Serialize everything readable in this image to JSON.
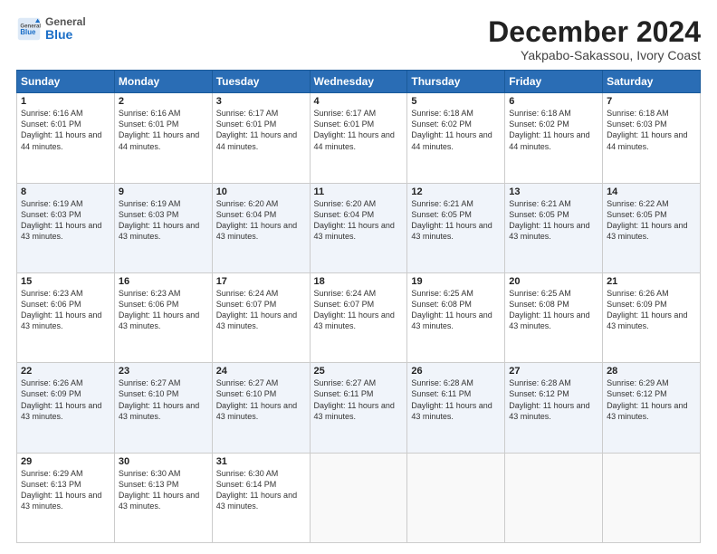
{
  "header": {
    "logo_general": "General",
    "logo_blue": "Blue",
    "month_title": "December 2024",
    "location": "Yakpabo-Sakassou, Ivory Coast"
  },
  "calendar": {
    "days_of_week": [
      "Sunday",
      "Monday",
      "Tuesday",
      "Wednesday",
      "Thursday",
      "Friday",
      "Saturday"
    ],
    "weeks": [
      [
        {
          "day": "1",
          "info": "Sunrise: 6:16 AM\nSunset: 6:01 PM\nDaylight: 11 hours and 44 minutes."
        },
        {
          "day": "2",
          "info": "Sunrise: 6:16 AM\nSunset: 6:01 PM\nDaylight: 11 hours and 44 minutes."
        },
        {
          "day": "3",
          "info": "Sunrise: 6:17 AM\nSunset: 6:01 PM\nDaylight: 11 hours and 44 minutes."
        },
        {
          "day": "4",
          "info": "Sunrise: 6:17 AM\nSunset: 6:01 PM\nDaylight: 11 hours and 44 minutes."
        },
        {
          "day": "5",
          "info": "Sunrise: 6:18 AM\nSunset: 6:02 PM\nDaylight: 11 hours and 44 minutes."
        },
        {
          "day": "6",
          "info": "Sunrise: 6:18 AM\nSunset: 6:02 PM\nDaylight: 11 hours and 44 minutes."
        },
        {
          "day": "7",
          "info": "Sunrise: 6:18 AM\nSunset: 6:03 PM\nDaylight: 11 hours and 44 minutes."
        }
      ],
      [
        {
          "day": "8",
          "info": "Sunrise: 6:19 AM\nSunset: 6:03 PM\nDaylight: 11 hours and 43 minutes."
        },
        {
          "day": "9",
          "info": "Sunrise: 6:19 AM\nSunset: 6:03 PM\nDaylight: 11 hours and 43 minutes."
        },
        {
          "day": "10",
          "info": "Sunrise: 6:20 AM\nSunset: 6:04 PM\nDaylight: 11 hours and 43 minutes."
        },
        {
          "day": "11",
          "info": "Sunrise: 6:20 AM\nSunset: 6:04 PM\nDaylight: 11 hours and 43 minutes."
        },
        {
          "day": "12",
          "info": "Sunrise: 6:21 AM\nSunset: 6:05 PM\nDaylight: 11 hours and 43 minutes."
        },
        {
          "day": "13",
          "info": "Sunrise: 6:21 AM\nSunset: 6:05 PM\nDaylight: 11 hours and 43 minutes."
        },
        {
          "day": "14",
          "info": "Sunrise: 6:22 AM\nSunset: 6:05 PM\nDaylight: 11 hours and 43 minutes."
        }
      ],
      [
        {
          "day": "15",
          "info": "Sunrise: 6:23 AM\nSunset: 6:06 PM\nDaylight: 11 hours and 43 minutes."
        },
        {
          "day": "16",
          "info": "Sunrise: 6:23 AM\nSunset: 6:06 PM\nDaylight: 11 hours and 43 minutes."
        },
        {
          "day": "17",
          "info": "Sunrise: 6:24 AM\nSunset: 6:07 PM\nDaylight: 11 hours and 43 minutes."
        },
        {
          "day": "18",
          "info": "Sunrise: 6:24 AM\nSunset: 6:07 PM\nDaylight: 11 hours and 43 minutes."
        },
        {
          "day": "19",
          "info": "Sunrise: 6:25 AM\nSunset: 6:08 PM\nDaylight: 11 hours and 43 minutes."
        },
        {
          "day": "20",
          "info": "Sunrise: 6:25 AM\nSunset: 6:08 PM\nDaylight: 11 hours and 43 minutes."
        },
        {
          "day": "21",
          "info": "Sunrise: 6:26 AM\nSunset: 6:09 PM\nDaylight: 11 hours and 43 minutes."
        }
      ],
      [
        {
          "day": "22",
          "info": "Sunrise: 6:26 AM\nSunset: 6:09 PM\nDaylight: 11 hours and 43 minutes."
        },
        {
          "day": "23",
          "info": "Sunrise: 6:27 AM\nSunset: 6:10 PM\nDaylight: 11 hours and 43 minutes."
        },
        {
          "day": "24",
          "info": "Sunrise: 6:27 AM\nSunset: 6:10 PM\nDaylight: 11 hours and 43 minutes."
        },
        {
          "day": "25",
          "info": "Sunrise: 6:27 AM\nSunset: 6:11 PM\nDaylight: 11 hours and 43 minutes."
        },
        {
          "day": "26",
          "info": "Sunrise: 6:28 AM\nSunset: 6:11 PM\nDaylight: 11 hours and 43 minutes."
        },
        {
          "day": "27",
          "info": "Sunrise: 6:28 AM\nSunset: 6:12 PM\nDaylight: 11 hours and 43 minutes."
        },
        {
          "day": "28",
          "info": "Sunrise: 6:29 AM\nSunset: 6:12 PM\nDaylight: 11 hours and 43 minutes."
        }
      ],
      [
        {
          "day": "29",
          "info": "Sunrise: 6:29 AM\nSunset: 6:13 PM\nDaylight: 11 hours and 43 minutes."
        },
        {
          "day": "30",
          "info": "Sunrise: 6:30 AM\nSunset: 6:13 PM\nDaylight: 11 hours and 43 minutes."
        },
        {
          "day": "31",
          "info": "Sunrise: 6:30 AM\nSunset: 6:14 PM\nDaylight: 11 hours and 43 minutes."
        },
        null,
        null,
        null,
        null
      ]
    ]
  }
}
